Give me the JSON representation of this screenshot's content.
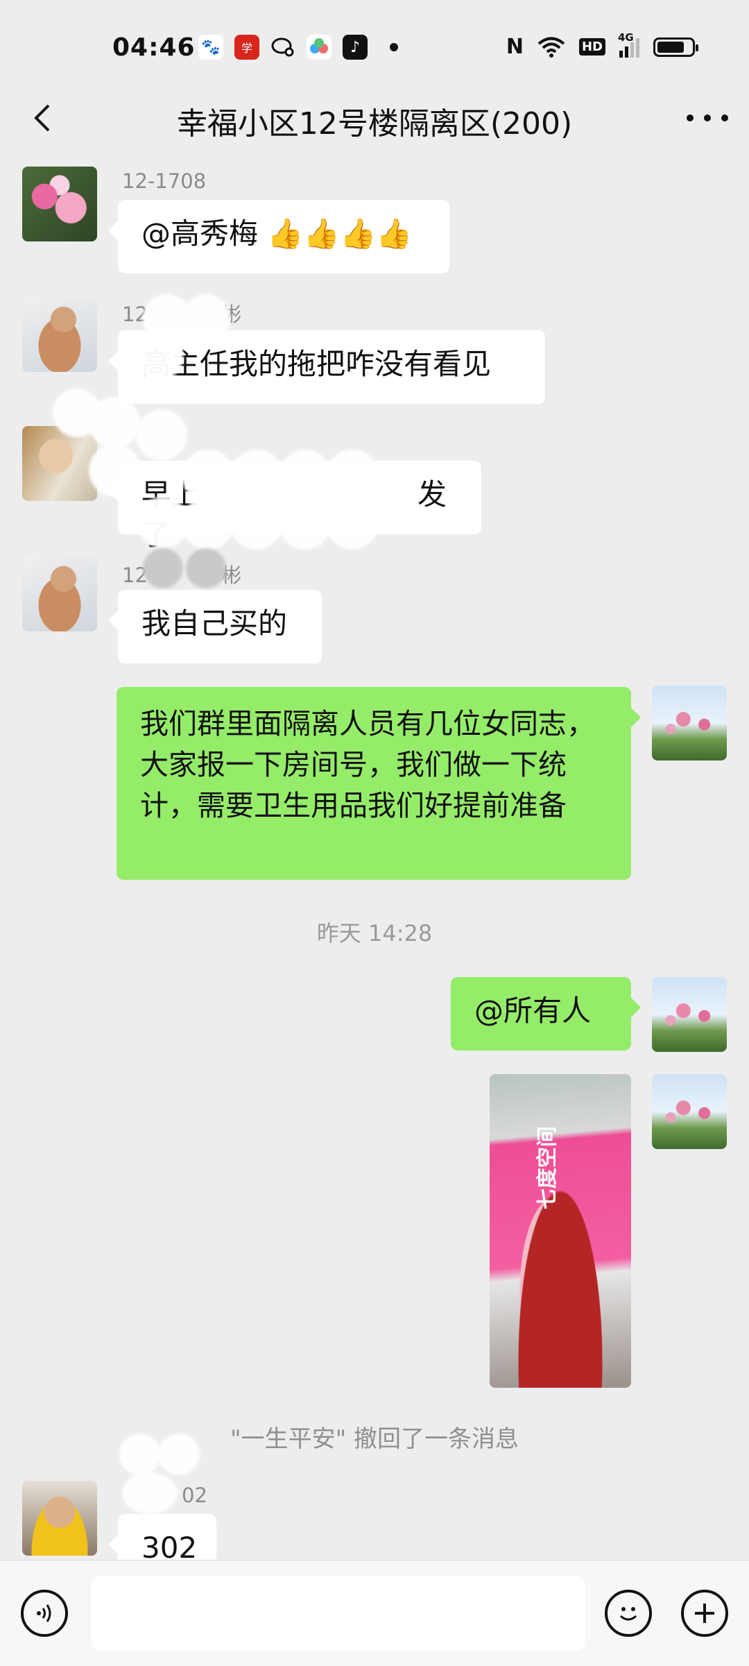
{
  "status_bar": {
    "time": "04:46",
    "app_icons": [
      "baidu-icon",
      "xuexi-icon",
      "chat-bubble-icon",
      "cloud-icon",
      "tiktok-icon"
    ],
    "network_label": "4G",
    "hd_label": "HD",
    "nfc_label": "N",
    "battery_level": 0.8
  },
  "nav": {
    "title": "幸福小区12号楼隔离区(200)"
  },
  "messages": [
    {
      "sender": "12-1708",
      "text": "@高秀梅 👍👍👍👍"
    },
    {
      "sender": "12-",
      "sender_tail": "彬",
      "text": "高主任我的拖把咋没有看见"
    },
    {
      "sender": "",
      "text_head": "早上",
      "text_tail": "发了"
    },
    {
      "sender": "12-",
      "sender_tail": "彬",
      "text": "我自己买的"
    },
    {
      "text": "我们群里面隔离人员有几位女同志，大家报一下房间号，我们做一下统计，需要卫生用品我们好提前准备"
    },
    {
      "text": "@所有人"
    },
    {
      "sender_tail": "02",
      "text": "302"
    }
  ],
  "timestamp": "昨天 14:28",
  "recall_notice": "\"一生平安\" 撤回了一条消息",
  "photo_label": "七度空间",
  "colors": {
    "background": "#ededed",
    "bubble_self": "#95ec69",
    "bubble_other": "#ffffff"
  }
}
